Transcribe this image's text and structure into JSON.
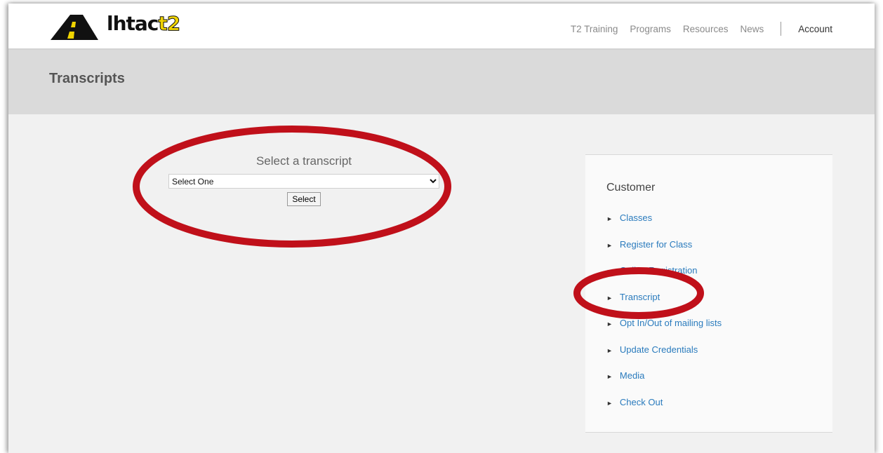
{
  "header": {
    "logo_text_a": "lhtac",
    "logo_text_b": "t2",
    "nav": [
      "T2 Training",
      "Programs",
      "Resources",
      "News"
    ],
    "account_label": "Account"
  },
  "banner": {
    "title": "Transcripts"
  },
  "picker": {
    "heading": "Select a transcript",
    "selected_option": "Select One",
    "button_label": "Select"
  },
  "sidebar": {
    "title": "Customer",
    "items": [
      {
        "label": "Classes"
      },
      {
        "label": "Register for Class"
      },
      {
        "label": "Online Registration"
      },
      {
        "label": "Transcript"
      },
      {
        "label": "Opt In/Out of mailing lists"
      },
      {
        "label": "Update Credentials"
      },
      {
        "label": "Media"
      },
      {
        "label": "Check Out"
      }
    ]
  },
  "colors": {
    "link": "#2a7bbd",
    "annotation": "#c0101a",
    "banner": "#dadada"
  }
}
